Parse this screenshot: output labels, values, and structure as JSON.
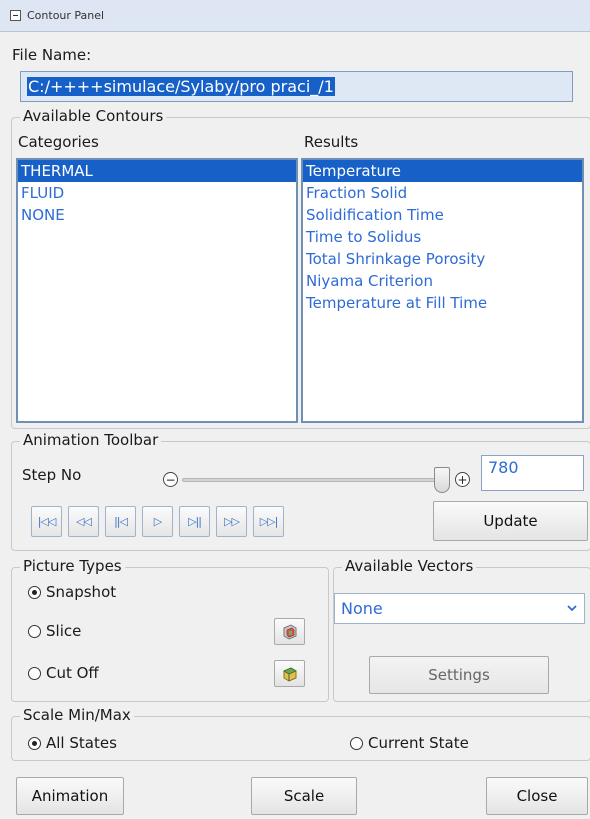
{
  "window": {
    "title": "Contour Panel"
  },
  "file": {
    "label": "File Name:",
    "value": "C:/++++simulace/Sylaby/pro praci_/1"
  },
  "contours": {
    "group_title": "Available Contours",
    "categories_label": "Categories",
    "results_label": "Results",
    "categories": [
      "THERMAL",
      "FLUID",
      "NONE"
    ],
    "selected_category": "THERMAL",
    "results": [
      "Temperature",
      "Fraction Solid",
      "Solidification Time",
      "Time to Solidus",
      "Total Shrinkage Porosity",
      "Niyama Criterion",
      "Temperature at Fill Time"
    ],
    "selected_result": "Temperature"
  },
  "animation_toolbar": {
    "group_title": "Animation Toolbar",
    "step_label": "Step No",
    "step_value": "780",
    "slider_fraction": 1.0,
    "decrement_icon": "minus-circle-icon",
    "increment_icon": "plus-circle-icon",
    "nav_buttons": [
      {
        "name": "first-frame",
        "glyph": "|◁◁"
      },
      {
        "name": "fast-back",
        "glyph": "◁◁"
      },
      {
        "name": "step-back",
        "glyph": "||◁"
      },
      {
        "name": "play",
        "glyph": "▷"
      },
      {
        "name": "step-forward",
        "glyph": "▷||"
      },
      {
        "name": "fast-forward",
        "glyph": "▷▷"
      },
      {
        "name": "last-frame",
        "glyph": "▷▷|"
      }
    ],
    "update_label": "Update"
  },
  "picture_types": {
    "group_title": "Picture Types",
    "options": [
      "Snapshot",
      "Slice",
      "Cut Off"
    ],
    "selected": "Snapshot"
  },
  "vectors": {
    "group_title": "Available Vectors",
    "selected_value": "None",
    "settings_label": "Settings"
  },
  "scale": {
    "group_title": "Scale Min/Max",
    "options": [
      "All States",
      "Current State"
    ],
    "selected": "All States"
  },
  "footer": {
    "animation_label": "Animation",
    "scale_label": "Scale",
    "close_label": "Close"
  },
  "colors": {
    "selection": "#1660c8",
    "list_text": "#2d6bd6",
    "panel_bg": "#f0f0f0"
  }
}
